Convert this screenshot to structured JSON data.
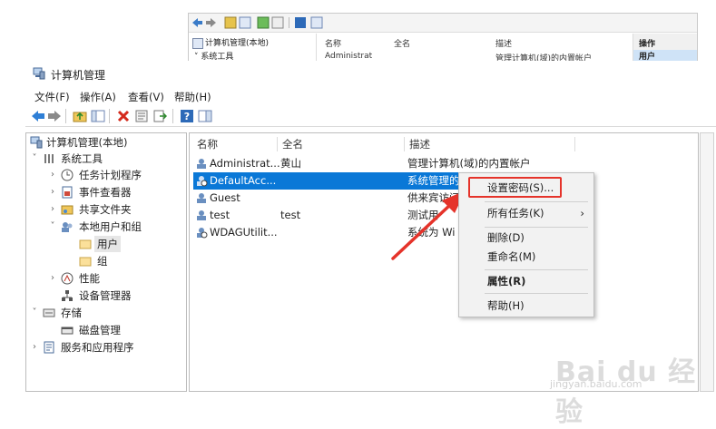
{
  "background_window": {
    "tree_root": "计算机管理(本地)",
    "tree_item": "系统工具",
    "col_name": "名称",
    "col_fullname": "全名",
    "col_desc": "描述",
    "row_name": "Administrat",
    "row_desc": "管理计算机(域)的内置帐户",
    "actions": "操作",
    "actions_sub": "用户"
  },
  "window": {
    "title": "计算机管理"
  },
  "menubar": {
    "file": "文件(F)",
    "action": "操作(A)",
    "view": "查看(V)",
    "help": "帮助(H)"
  },
  "tree": {
    "items": [
      {
        "label": "计算机管理(本地)",
        "icon": "computer-management-icon"
      },
      {
        "label": "系统工具",
        "icon": "system-tools-icon"
      },
      {
        "label": "任务计划程序",
        "icon": "clock-icon"
      },
      {
        "label": "事件查看器",
        "icon": "event-viewer-icon"
      },
      {
        "label": "共享文件夹",
        "icon": "shared-folder-icon"
      },
      {
        "label": "本地用户和组",
        "icon": "users-icon"
      },
      {
        "label": "用户",
        "icon": "folder-icon"
      },
      {
        "label": "组",
        "icon": "folder-icon"
      },
      {
        "label": "性能",
        "icon": "performance-icon"
      },
      {
        "label": "设备管理器",
        "icon": "device-manager-icon"
      },
      {
        "label": "存储",
        "icon": "storage-icon"
      },
      {
        "label": "磁盘管理",
        "icon": "disk-icon"
      },
      {
        "label": "服务和应用程序",
        "icon": "services-icon"
      }
    ]
  },
  "list": {
    "headers": {
      "name": "名称",
      "fullname": "全名",
      "desc": "描述"
    },
    "rows": [
      {
        "name": "Administrat...",
        "fullname": "黄山",
        "desc": "管理计算机(域)的内置帐户"
      },
      {
        "name": "DefaultAcc...",
        "fullname": "",
        "desc": "系统管理的"
      },
      {
        "name": "Guest",
        "fullname": "",
        "desc": "供来宾访问"
      },
      {
        "name": "test",
        "fullname": "test",
        "desc": "测试用"
      },
      {
        "name": "WDAGUtilit...",
        "fullname": "",
        "desc": "系统为 Wi"
      }
    ]
  },
  "context_menu": {
    "set_password": "设置密码(S)...",
    "all_tasks": "所有任务(K)",
    "all_tasks_arrow": "›",
    "delete": "删除(D)",
    "rename": "重命名(M)",
    "properties": "属性(R)",
    "help": "帮助(H)"
  },
  "watermark": {
    "brand": "Bai du 经验",
    "url": "jingyan.baidu.com"
  },
  "colors": {
    "selection": "#0a78d7",
    "highlight_box": "#e5332a",
    "arrow": "#e5332a"
  }
}
